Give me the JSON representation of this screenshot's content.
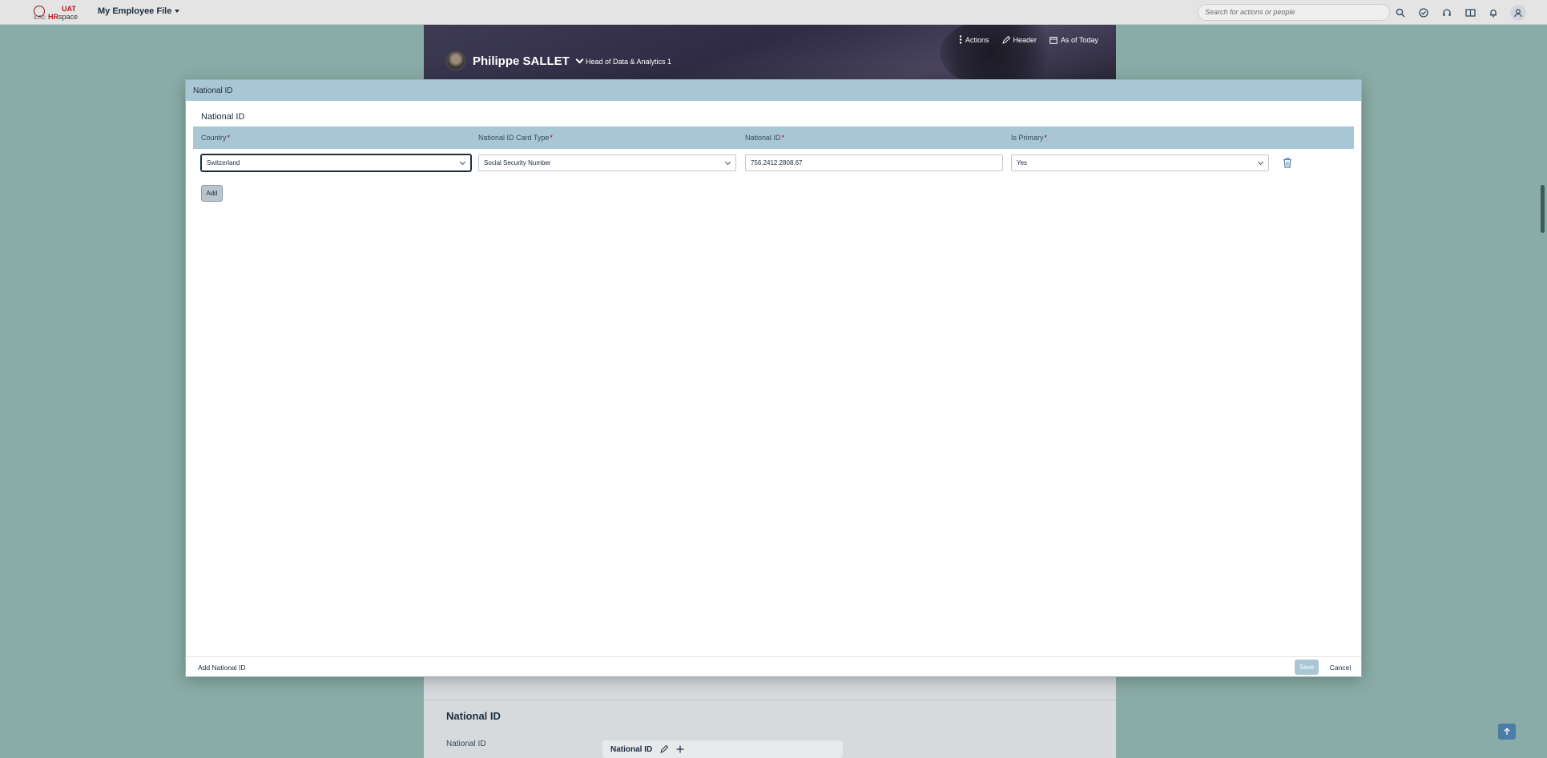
{
  "shell": {
    "logo": {
      "seal_text": "ICRC",
      "env": "UAT",
      "brand_prefix": "HR",
      "brand_suffix": "space"
    },
    "app_menu_label": "My Employee File",
    "search_placeholder": "Search for actions or people",
    "icons": [
      "search-icon",
      "check-circle-icon",
      "headset-icon",
      "book-icon",
      "bell-icon",
      "user-icon"
    ]
  },
  "profile": {
    "name": "Philippe SALLET",
    "job_title": "Head of Data & Analytics 1",
    "actions": {
      "actions_label": "Actions",
      "header_label": "Header",
      "as_of_label": "As of Today"
    }
  },
  "background_section": {
    "title": "National ID",
    "field_label": "National ID",
    "card_label": "National ID"
  },
  "dialog": {
    "title": "National ID",
    "subtitle": "National ID",
    "columns": [
      {
        "label": "Country",
        "required": "*"
      },
      {
        "label": "National ID Card Type",
        "required": "*"
      },
      {
        "label": "National ID",
        "required": "*"
      },
      {
        "label": "Is Primary",
        "required": "*"
      }
    ],
    "row": {
      "country": "Switzerland",
      "card_type": "Social Security Number",
      "national_id": "756.2412.2808.67",
      "is_primary": "Yes"
    },
    "add_label": "Add",
    "footer": {
      "left_label": "Add National ID",
      "save_label": "Save",
      "cancel_label": "Cancel"
    }
  },
  "colors": {
    "overlay_bg": "#8aaca6",
    "dialog_header": "#a9c6d5",
    "brand_red": "#c0141f",
    "required": "#bb0000"
  }
}
